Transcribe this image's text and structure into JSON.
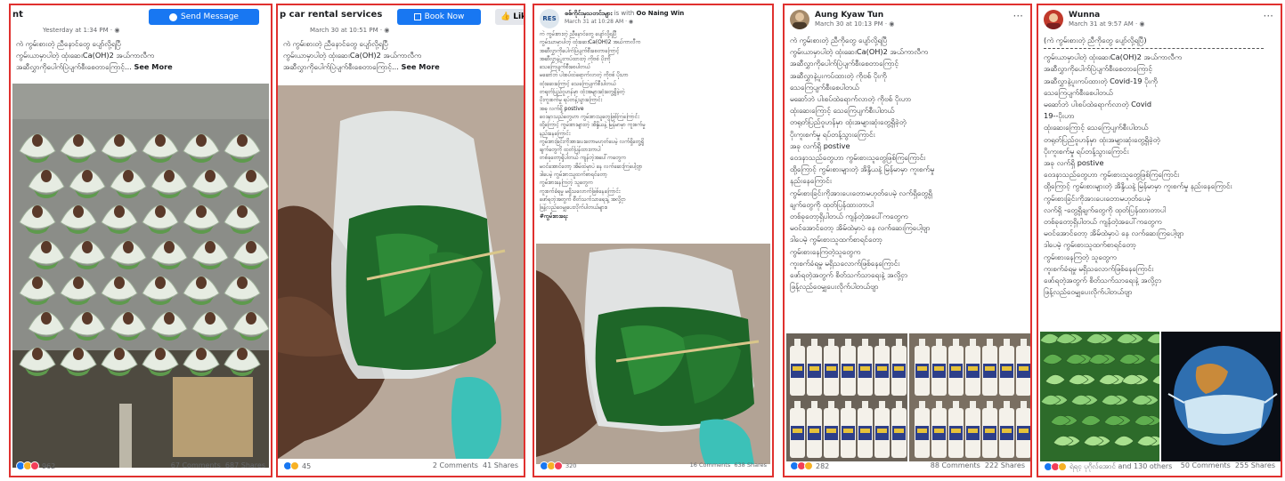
{
  "colors": {
    "frame": "#e0312f",
    "fb_blue": "#1877f2",
    "meta_gray": "#65676b"
  },
  "panels": [
    {
      "top_name": "nt",
      "author": "",
      "meta": "Yesterday at 1:34 PM · ",
      "action_label": "Send Message",
      "text": [
        "ကဲ ကွမ်းစားတဲ့ ညီနောင်တွေ ပျော်လို့ရပြီ",
        "ကွမ်းယာမှာပါတဲ့ ထုံးဆေးCa(OH)2 အယ်ကာလီက",
        "အဆီလွှာကိုပေါက်ပြဲပျက်စီးစေတာကြောင့်... "
      ],
      "see_more": "See More",
      "reactions": "962",
      "comments": "67 Comments",
      "shares": "687 Shares"
    },
    {
      "top_name": "p car rental services",
      "author": "",
      "meta": "March 30 at 10:51 PM · ",
      "action_label": "Book Now",
      "like_label": "Like",
      "text": [
        "ကဲ ကွမ်းစားတဲ့ ညီနောင်တွေ ပျော်လို့ရပြီ",
        "ကွမ်းယာမှာပါတဲ့ ထုံးဆေးCa(OH)2 အယ်ကာလီက",
        "အဆီလွှာကိုပေါက်ပြဲပျက်စီးစေတာကြောင့်... "
      ],
      "see_more": "See More",
      "reactions": "45",
      "comments": "2 Comments",
      "shares": "41 Shares"
    },
    {
      "author": "စစ်ကိုင်းမှသတင်းများ",
      "with_text": " is with ",
      "with_name": "Oo Naing Win",
      "meta": "March 31 at 10:28 AM · ",
      "avatar_text": "RES",
      "text": [
        "ကဲ ကွမ်းစားတဲ့ ညီနောင်တွေ ပျော်လို့ရပြီ",
        "ကွမ်းယာမှာပါတဲ့ ထုံးဆေးCa(OH)2 အယ်ကာလီက",
        "အဆီလွှာကိုပေါက်ပြဲပျက်စီးစေတာကြောင့်",
        "အဆီလွှာနဲ့ပူးကပ်ထားတဲ့ ကိုဗစ် ပိုးကို",
        "သေကြေပျက်စီးစေပါတယ်",
        "မဆော်ဘဲ ပါးစပ်ထဲရောက်လာတဲ့ ကိုဗစ် ပိုးဟာ",
        "ထုံးဆေးကြောင့် သေကြေပျက်စီးပါတယ်",
        "တရုတ်ပြည်ဝူဟန်မှာ ထုံးအများဆုံးတွေ့ရှိခဲ့တဲ့",
        "ပိုးကူးစက်မှု ရပ်တန့်သွားကြောင်း",
        "အခု လက်ရှိ postive",
        "ဝေဒနာသည်တွေဟာ ကွမ်းစားသူတွေဖြစ်ကြကြောင်း",
        "ထို့ကြောင့် ကွမ်းစားများတဲ့ အိန္ဒိယနဲ့ မြန်မာမှာ ကူးစက်မှု",
        "နည်းနေကြောင်း",
        "ကွမ်းစားခြင်းကိုအားပေးတောမဟုတ်ပေမဲ့ လက်ရှိတွေ့ရှိ",
        "ချက်တွေကို ထုတ်ပြန်ထားတာပါ",
        "တစ်ခုတော့ရှိပါတယ် ကျန်တဲ့အပေါ်ကတွေက",
        "မဝင်အောင်တော့ အိမ်ထဲမှာပဲ နေ လက်ဆေးကြပေါ့ဗျာ",
        "ဒါပေမဲ့ ကွမ်းစားသူထက်စာရင်တော့",
        "ကွမ်းစားနေကြတဲ့ သူတွေက",
        "ကူးစက်ခံရမှု မရှိသလောက်ဖြစ်နေကြောင်း",
        "ဖော်ရ​တဲ့အတွက် စီတ်သက်သာရေးနဲ့ အလို့ငှာ",
        "ဖြန့်လည်ဝေမျှပေးလိုက်ပါတယ်များ။",
        "#ကွမ်းစားရေး"
      ],
      "reactions": "320",
      "comments": "16 Comments",
      "shares": "638 Shares"
    },
    {
      "author": "Aung Kyaw Tun",
      "meta": "March 30 at 10:13 PM · ",
      "text": [
        "ကဲ ကွမ်းစားတဲ့ ညီကိုတွေ ပျော်လို့ရပြီ",
        "ကွမ်းယာမှာပါတဲ့ ထုံးဆေးCa(OH)2 အယ်ကာလီက",
        "အဆီလွှာကိုပေါက်ပြဲပျက်စီးစေတာကြောင့်",
        "အဆီလွှာနဲ့ပူးကပ်ထားတဲ့ ကိုဗစ် ပိုးကို",
        "သေကြေပျက်စီးစေပါတယ်",
        "မဆော်ဘဲ ပါးစပ်ထဲရောက်လာတဲ့ ကိုဗစ် ပိုးဟာ",
        "ထုံးဆေးကြောင့် သေကြေပျက်စီးပါတယ်",
        "တရုတ်ပြည်ဝူဟန်မှာ ထုံးအများဆုံးတွေ့ရှိခဲ့တဲ့",
        "ပိုးကူးစက်မှု ရပ်တန့်သွားကြောင်း",
        "အခု လက်ရှိ postive",
        "ဝေဒနာသည်တွေဟာ ကွမ်းစားသူတွေဖြစ်ကြကြောင်း",
        "ထို့ကြောင့် ကွမ်းစားများတဲ့ အိန္ဒိယနဲ့ မြန်မာမှာ ကူးစက်မှု",
        "နည်းနေကြောင်း",
        "ကွမ်းစားခြင်းကိုအားပေးတောမဟုတ်ပေမဲ့ လက်ရှိတွေ့ရှိ",
        "ချက်တွေကို ထုတ်ပြန်ထားတာပါ",
        "တစ်ခုတော့ရှိပါတယ် ကျန်တဲ့အပေါ်ကတွေက",
        "မဝင်အောင်တော့ အိမ်ထဲမှာပဲ နေ လက်ဆေးကြပေါ့ဗျာ",
        "ဒါပေမဲ့ ကွမ်းစားသူထက်စာရင်တော့",
        "ကွမ်းစားနေကြတဲ့သူတွေက",
        "ကူးစက်ခံရမှု မရှိသလောက်ဖြစ်နေကြောင်း",
        "ဖော်ရတဲ့အတွက် စိတ်သက်သာရေးနဲ့ အလို့ငှာ",
        "ဖြန့်လည်ဝေမျှပေးလိုက်ပါတယ်ဗျာ"
      ],
      "reactions": "282",
      "comments": "88 Comments",
      "shares": "222 Shares"
    },
    {
      "author": "Wunna",
      "meta": "March 31 at 9:57 AM · ",
      "text": [
        "(ကဲ ကွမ်းစားတဲ့ ညီကိုတွေ ပျော်လို့ရပြီ)",
        "ကွမ်းယာမှာပါတဲ့ ထုံးဆေးCa(OH)2 အယ်ကာလီက",
        "အဆီလွှာကိုပေါက်ပြဲပျက်စီးစေတာကြောင့်",
        "အဆီလွှာနဲ့ပူးကပ်ထားတဲ့ Covid-19 ပိုးကို",
        "သေကြေပျက်စီးစေပါတယ်",
        "မဆော်ဘဲ ပါးစပ်ထဲရောက်လာတဲ့ Covid",
        "19--ပိုးဟာ",
        "ထုံးဆေးကြောင့် သေကြေပျက်စီးပါတယ်",
        "တရုတ်ပြည်ဝူဟန်မှာ ထုံးအများဆုံးတွေ့ရှိခဲ့တဲ့",
        "ပိုးကူးစက်မှု ရပ်တန့်သွားကြောင်း",
        "အခု လက်ရှိ postive",
        "ဝေဒနာသည်တွေဟာ ကွမ်းစားသူတွေဖြစ်ကြကြောင်း",
        "ထို့ကြောင့် ကွမ်းစားများတဲ့ အိန္ဒိယနဲ့ မြန်မာမှာ ကူးစက်မှု နည်းနေကြောင်း",
        "ကွမ်းစားခြင်းကိုအားပေးတောမဟုတ်ပေမဲ့",
        "လက်ရှိ -တွေ့ရှိချက်တွေကို ထုတ်ပြန်ထားတာပါ",
        "တစ်ခုတော့ရှိပါတယ် ကျန်တဲ့အပေါ်ကတွေက",
        "မဝင်အောင်တော့ အိမ်ထဲမှာပဲ နေ လက်ဆေးကြပေါ့ဗျာ",
        "ဒါပေမဲ့ ကွမ်းစားသူထက်စာရင်တော့",
        "ကွမ်းစားနေကြတဲ့ သူတွေက",
        "ကူးစက်ခံရမှု မရှိသလောက်ဖြစ်နေကြောင်း",
        "ဖော်ရတဲ့အတွက် စိတ်သက်သာရေးနဲ့ အလို့ငှာ",
        "ဖြန့်လည်ဝေမျှပေးလိုက်ပါတယ်ဗျာ"
      ],
      "reactions": "ရဲရင့ ပုဂိုလ်အောင် and 130 others",
      "comments": "50 Comments",
      "shares": "255 Shares"
    }
  ]
}
